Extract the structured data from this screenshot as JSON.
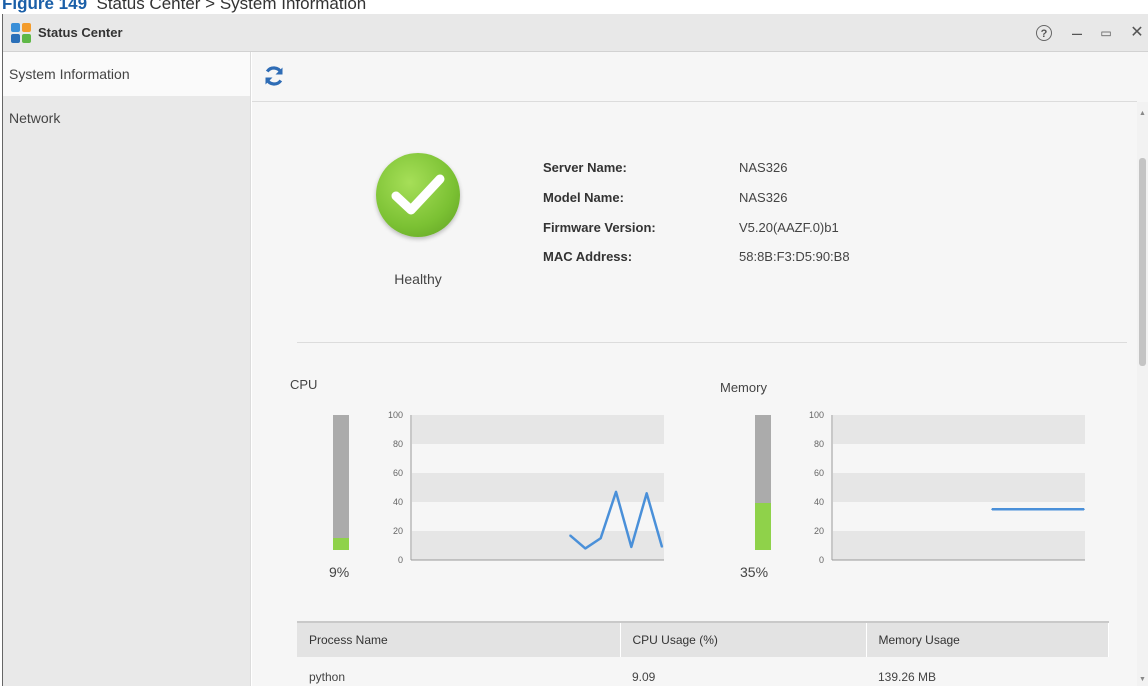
{
  "figure_caption": {
    "prefix": "Figure 149",
    "text": "Status Center > System Information"
  },
  "window": {
    "title": "Status Center",
    "help": "?",
    "minimize": "–",
    "maximize": "▭",
    "close": "✕"
  },
  "sidebar": {
    "items": [
      {
        "label": "System Information",
        "active": true
      },
      {
        "label": "Network",
        "active": false
      }
    ]
  },
  "status": {
    "health": "Healthy"
  },
  "system_info": [
    {
      "label": "Server Name:",
      "value": "NAS326"
    },
    {
      "label": "Model Name:",
      "value": "NAS326"
    },
    {
      "label": "Firmware Version:",
      "value": "V5.20(AAZF.0)b1"
    },
    {
      "label": "MAC Address:",
      "value": "58:8B:F3:D5:90:B8"
    }
  ],
  "cpu": {
    "label": "CPU",
    "percent_text": "9%",
    "percent": 9
  },
  "memory": {
    "label": "Memory",
    "percent_text": "35%",
    "percent": 35
  },
  "chart_data": [
    {
      "type": "line",
      "title": "CPU",
      "y_ticks": [
        "100",
        "80",
        "60",
        "40",
        "20",
        "0"
      ],
      "ylim": [
        0,
        100
      ],
      "series": [
        {
          "values": [
            17,
            8,
            15,
            47,
            9,
            46,
            9
          ]
        }
      ]
    },
    {
      "type": "line",
      "title": "Memory",
      "y_ticks": [
        "100",
        "80",
        "60",
        "40",
        "20",
        "0"
      ],
      "ylim": [
        0,
        100
      ],
      "series": [
        {
          "values": [
            35,
            35
          ]
        }
      ]
    }
  ],
  "process_table": {
    "headers": [
      "Process Name",
      "CPU Usage (%)",
      "Memory Usage"
    ],
    "rows": [
      [
        "python",
        "9.09",
        "139.26 MB"
      ]
    ]
  },
  "colors": {
    "accent": "#2e6cb5",
    "healthy": "#7bc133",
    "line": "#4a90d9",
    "bar_fill": "#8fd24a"
  }
}
